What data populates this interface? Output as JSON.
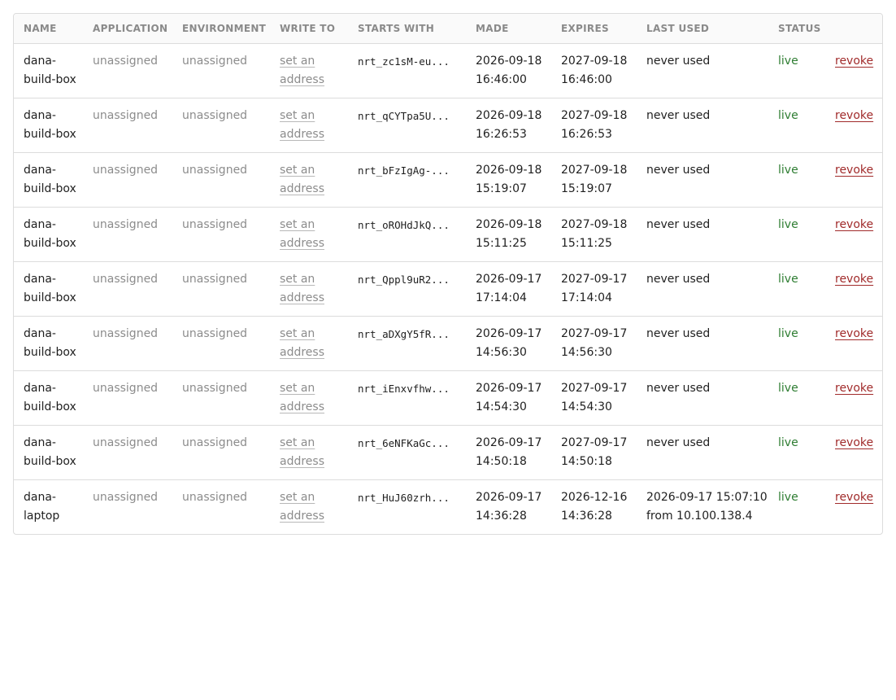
{
  "table": {
    "headers": [
      "NAME",
      "APPLICATION",
      "ENVIRONMENT",
      "WRITE TO",
      "STARTS WITH",
      "MADE",
      "EXPIRES",
      "LAST USED",
      "STATUS",
      ""
    ],
    "rows": [
      {
        "name": "dana-build-box",
        "application": "unassigned",
        "environment": "unassigned",
        "write_to": "set an address",
        "starts_with": "nrt_zc1sM-eu...",
        "made": "2026-09-18 16:46:00",
        "expires": "2027-09-18 16:46:00",
        "last_used": "never used",
        "status": "live",
        "action": "revoke"
      },
      {
        "name": "dana-build-box",
        "application": "unassigned",
        "environment": "unassigned",
        "write_to": "set an address",
        "starts_with": "nrt_qCYTpa5U...",
        "made": "2026-09-18 16:26:53",
        "expires": "2027-09-18 16:26:53",
        "last_used": "never used",
        "status": "live",
        "action": "revoke"
      },
      {
        "name": "dana-build-box",
        "application": "unassigned",
        "environment": "unassigned",
        "write_to": "set an address",
        "starts_with": "nrt_bFzIgAg-...",
        "made": "2026-09-18 15:19:07",
        "expires": "2027-09-18 15:19:07",
        "last_used": "never used",
        "status": "live",
        "action": "revoke"
      },
      {
        "name": "dana-build-box",
        "application": "unassigned",
        "environment": "unassigned",
        "write_to": "set an address",
        "starts_with": "nrt_oROHdJkQ...",
        "made": "2026-09-18 15:11:25",
        "expires": "2027-09-18 15:11:25",
        "last_used": "never used",
        "status": "live",
        "action": "revoke"
      },
      {
        "name": "dana-build-box",
        "application": "unassigned",
        "environment": "unassigned",
        "write_to": "set an address",
        "starts_with": "nrt_Qppl9uR2...",
        "made": "2026-09-17 17:14:04",
        "expires": "2027-09-17 17:14:04",
        "last_used": "never used",
        "status": "live",
        "action": "revoke"
      },
      {
        "name": "dana-build-box",
        "application": "unassigned",
        "environment": "unassigned",
        "write_to": "set an address",
        "starts_with": "nrt_aDXgY5fR...",
        "made": "2026-09-17 14:56:30",
        "expires": "2027-09-17 14:56:30",
        "last_used": "never used",
        "status": "live",
        "action": "revoke"
      },
      {
        "name": "dana-build-box",
        "application": "unassigned",
        "environment": "unassigned",
        "write_to": "set an address",
        "starts_with": "nrt_iEnxvfhw...",
        "made": "2026-09-17 14:54:30",
        "expires": "2027-09-17 14:54:30",
        "last_used": "never used",
        "status": "live",
        "action": "revoke"
      },
      {
        "name": "dana-build-box",
        "application": "unassigned",
        "environment": "unassigned",
        "write_to": "set an address",
        "starts_with": "nrt_6eNFKaGc...",
        "made": "2026-09-17 14:50:18",
        "expires": "2027-09-17 14:50:18",
        "last_used": "never used",
        "status": "live",
        "action": "revoke"
      },
      {
        "name": "dana-laptop",
        "application": "unassigned",
        "environment": "unassigned",
        "write_to": "set an address",
        "starts_with": "nrt_HuJ60zrh...",
        "made": "2026-09-17 14:36:28",
        "expires": "2026-12-16 14:36:28",
        "last_used": "2026-09-17 15:07:10 from 10.100.138.4",
        "status": "live",
        "action": "revoke"
      }
    ]
  },
  "colors": {
    "status_live": "#2e7d32",
    "revoke_link": "#a12b2b",
    "muted_text": "#8c8c8c",
    "border": "#dcdcdc"
  }
}
